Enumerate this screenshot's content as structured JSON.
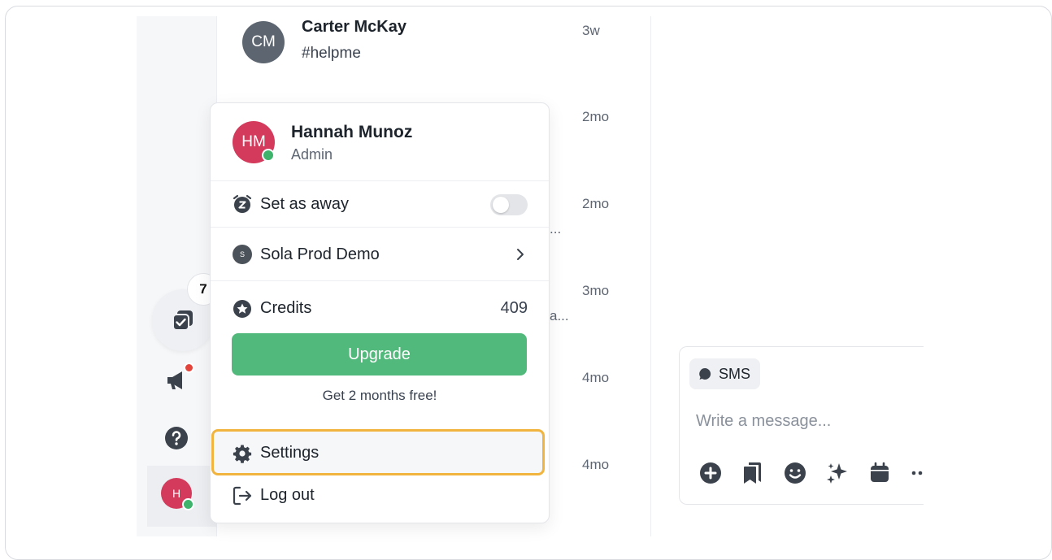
{
  "conversations": [
    {
      "initials": "CM",
      "name": "Carter McKay",
      "preview": "#helpme",
      "time": "3w"
    },
    {
      "time": "2mo"
    },
    {
      "time": "2mo",
      "truncated": "..."
    },
    {
      "time": "3mo",
      "truncated": "a..."
    },
    {
      "time": "4mo"
    },
    {
      "time": "4mo"
    }
  ],
  "rail": {
    "tasks_badge": "7",
    "user_initial": "H"
  },
  "menu": {
    "user": {
      "initials": "HM",
      "name": "Hannah Munoz",
      "role": "Admin"
    },
    "set_away_label": "Set as away",
    "workspace": {
      "initial": "S",
      "name": "Sola Prod Demo"
    },
    "credits_label": "Credits",
    "credits_value": "409",
    "upgrade_label": "Upgrade",
    "promo_text": "Get 2 months free!",
    "settings_label": "Settings",
    "logout_label": "Log out"
  },
  "composer": {
    "channel_label": "SMS",
    "placeholder": "Write a message..."
  },
  "colors": {
    "accent_green": "#52b97c",
    "highlight": "#f1b53f",
    "avatar_red": "#d33a5b",
    "online": "#3fb36c"
  }
}
